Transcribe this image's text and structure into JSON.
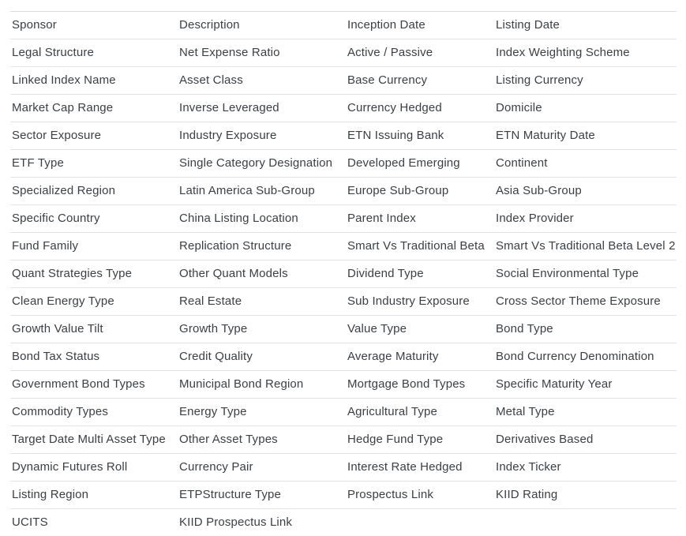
{
  "table": {
    "columns": 4,
    "text_color": "#3b4045",
    "row_divider_color": "#e2e2e2",
    "top_border_color": "#dddddd",
    "rows": [
      [
        "Sponsor",
        "Description",
        "Inception Date",
        "Listing Date"
      ],
      [
        "Legal Structure",
        "Net Expense Ratio",
        "Active / Passive",
        "Index Weighting Scheme"
      ],
      [
        "Linked Index Name",
        "Asset Class",
        "Base Currency",
        "Listing Currency"
      ],
      [
        "Market Cap Range",
        "Inverse Leveraged",
        "Currency Hedged",
        "Domicile"
      ],
      [
        "Sector Exposure",
        "Industry Exposure",
        "ETN Issuing Bank",
        "ETN Maturity Date"
      ],
      [
        "ETF Type",
        "Single Category Designation",
        "Developed Emerging",
        "Continent"
      ],
      [
        "Specialized Region",
        "Latin America Sub-Group",
        "Europe Sub-Group",
        "Asia Sub-Group"
      ],
      [
        "Specific Country",
        "China Listing Location",
        "Parent Index",
        "Index Provider"
      ],
      [
        "Fund Family",
        "Replication Structure",
        "Smart Vs Traditional Beta",
        "Smart Vs Traditional Beta Level 2"
      ],
      [
        "Quant Strategies Type",
        "Other Quant Models",
        "Dividend Type",
        "Social Environmental Type"
      ],
      [
        "Clean Energy Type",
        "Real Estate",
        "Sub Industry Exposure",
        "Cross Sector Theme Exposure"
      ],
      [
        "Growth Value Tilt",
        "Growth Type",
        "Value Type",
        "Bond Type"
      ],
      [
        "Bond Tax Status",
        "Credit Quality",
        "Average Maturity",
        "Bond Currency Denomination"
      ],
      [
        "Government Bond Types",
        "Municipal Bond Region",
        "Mortgage Bond Types",
        "Specific Maturity Year"
      ],
      [
        "Commodity Types",
        "Energy Type",
        "Agricultural Type",
        "Metal Type"
      ],
      [
        "Target Date Multi Asset Type",
        "Other Asset Types",
        "Hedge Fund Type",
        "Derivatives Based"
      ],
      [
        "Dynamic Futures Roll",
        "Currency Pair",
        "Interest Rate Hedged",
        "Index Ticker"
      ],
      [
        "Listing Region",
        "ETPStructure Type",
        "Prospectus Link",
        "KIID Rating"
      ],
      [
        "UCITS",
        "KIID Prospectus Link",
        "",
        ""
      ]
    ]
  }
}
